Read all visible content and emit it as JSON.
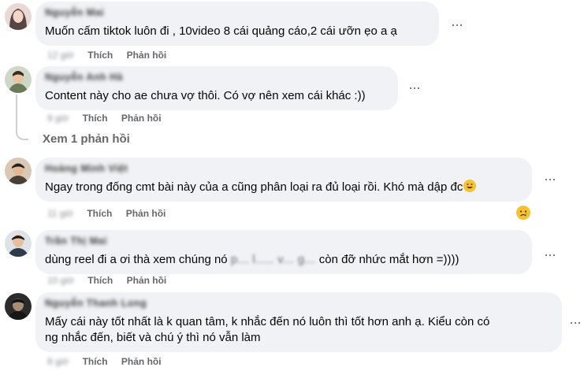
{
  "comments": [
    {
      "author": "Nguyễn Mai",
      "text": "Muốn cấm tiktok luôn đi , 10video 8 cái quảng cáo,2 cái ưỡn ẹo a ạ",
      "time": "12 giờ",
      "like_label": "Thích",
      "reply_label": "Phản hồi"
    },
    {
      "author": "Nguyễn Anh Hà",
      "text": "Content này cho ae chưa vợ thôi. Có vợ nên xem cái khác :))",
      "time": "9 giờ",
      "like_label": "Thích",
      "reply_label": "Phản hồi",
      "view_replies": "Xem 1 phản hồi"
    },
    {
      "author": "Hoàng Minh Việt",
      "text": "Ngay trong đống cmt bài này của a cũng phân loại ra đủ loại rồi. Khó mà dập đc",
      "time": "11 giờ",
      "like_label": "Thích",
      "reply_label": "Phản hồi"
    },
    {
      "author": "Trần Thị Mai",
      "text_before": "dùng reel đi a ơi thà xem chúng nó ",
      "text_censored": "p... l..... v... g...",
      "text_after": " còn đỡ nhức mắt hơn =))))",
      "time": "10 giờ",
      "like_label": "Thích",
      "reply_label": "Phản hồi"
    },
    {
      "author": "Nguyễn Thanh Long",
      "text_line1": "Mấy cái này tốt nhất là k quan tâm, k nhắc đến nó luôn thì tốt hơn anh ạ. Kiểu còn có",
      "text_line2": "ng nhắc đến, biết và chú ý thì nó vẫn làm",
      "time": "8 giờ",
      "like_label": "Thích",
      "reply_label": "Phản hồi"
    }
  ],
  "more_options_glyph": "···",
  "colors": {
    "bubble": "#f0f2f5",
    "meta": "#65676b",
    "text": "#050505",
    "emoji": "#f7c22f"
  }
}
